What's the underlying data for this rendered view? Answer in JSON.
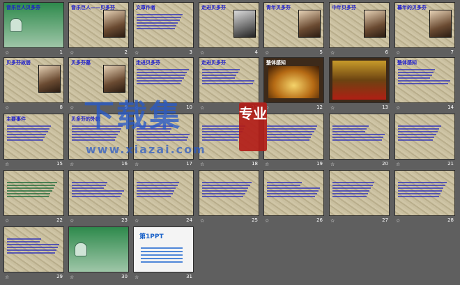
{
  "app": {
    "view": "slide-sorter"
  },
  "slides": [
    {
      "n": "1",
      "title": "音乐巨人贝多芬",
      "kind": "cover"
    },
    {
      "n": "2",
      "title": "音乐巨人——贝多芬",
      "kind": "portrait"
    },
    {
      "n": "3",
      "title": "文章作者",
      "kind": "text"
    },
    {
      "n": "4",
      "title": "走进贝多芬",
      "kind": "portrait-bw"
    },
    {
      "n": "5",
      "title": "青年贝多芬",
      "kind": "portrait"
    },
    {
      "n": "6",
      "title": "中年贝多芬",
      "kind": "portrait"
    },
    {
      "n": "7",
      "title": "暮年的贝多芬",
      "kind": "portrait"
    },
    {
      "n": "8",
      "title": "贝多芬故居",
      "kind": "photo"
    },
    {
      "n": "9",
      "title": "贝多芬墓",
      "kind": "photo"
    },
    {
      "n": "10",
      "title": "走进贝多芬",
      "kind": "text"
    },
    {
      "n": "11",
      "title": "走进贝多芬",
      "kind": "text"
    },
    {
      "n": "12",
      "title": "整体感知",
      "kind": "stage"
    },
    {
      "n": "13",
      "title": "",
      "kind": "hall"
    },
    {
      "n": "14",
      "title": "整体感知",
      "kind": "text"
    },
    {
      "n": "15",
      "title": "主要事件",
      "kind": "text"
    },
    {
      "n": "16",
      "title": "贝多芬的外貌",
      "kind": "text"
    },
    {
      "n": "17",
      "title": "",
      "kind": "text"
    },
    {
      "n": "18",
      "title": "",
      "kind": "text"
    },
    {
      "n": "19",
      "title": "",
      "kind": "text"
    },
    {
      "n": "20",
      "title": "",
      "kind": "text"
    },
    {
      "n": "21",
      "title": "",
      "kind": "text"
    },
    {
      "n": "22",
      "title": "",
      "kind": "text-green"
    },
    {
      "n": "23",
      "title": "",
      "kind": "text"
    },
    {
      "n": "24",
      "title": "",
      "kind": "text"
    },
    {
      "n": "25",
      "title": "",
      "kind": "text-dark"
    },
    {
      "n": "26",
      "title": "",
      "kind": "text-dark"
    },
    {
      "n": "27",
      "title": "",
      "kind": "text-dark"
    },
    {
      "n": "28",
      "title": "",
      "kind": "text-dark"
    },
    {
      "n": "29",
      "title": "",
      "kind": "text"
    },
    {
      "n": "30",
      "title": "",
      "kind": "green"
    },
    {
      "n": "31",
      "title": "第1PPT",
      "kind": "ppt"
    }
  ],
  "watermark": {
    "main": "下载集",
    "badge": "专业",
    "url": "www.xiazai.com"
  },
  "colors": {
    "background": "#5f5f5f",
    "title_blue": "#1d1dcc",
    "watermark_red": "#b21d18"
  }
}
